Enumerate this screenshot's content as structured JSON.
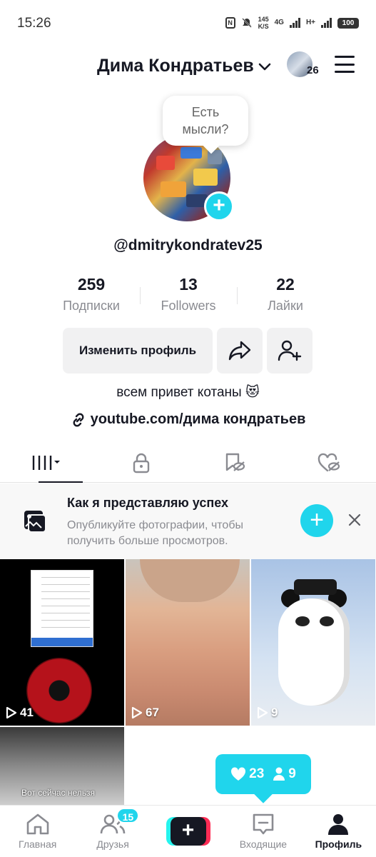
{
  "status_bar": {
    "time": "15:26",
    "speed_value": "145",
    "speed_unit": "K/S",
    "net1": "4G",
    "net2": "H+",
    "battery": "100"
  },
  "header": {
    "name": "Дима Кондратьев",
    "story_count": "26"
  },
  "avatar_bubble": {
    "line1": "Есть",
    "line2": "мысли?"
  },
  "profile": {
    "username": "@dmitrykondratev25",
    "stats": [
      {
        "value": "259",
        "label": "Подписки"
      },
      {
        "value": "13",
        "label": "Followers"
      },
      {
        "value": "22",
        "label": "Лайки"
      }
    ],
    "edit_button": "Изменить профиль",
    "bio": "всем привет котаны 😻",
    "link": "youtube.com/дима кондратьев"
  },
  "promo": {
    "title": "Как я представляю успех",
    "text": "Опубликуйте фотографии, чтобы получить больше просмотров."
  },
  "videos": [
    {
      "views": "41"
    },
    {
      "views": "67"
    },
    {
      "views": "9"
    },
    {
      "caption": "Вот сейчас нельзя"
    }
  ],
  "notification": {
    "likes": "23",
    "followers": "9"
  },
  "nav": {
    "home": "Главная",
    "friends": "Друзья",
    "friends_badge": "15",
    "inbox": "Входящие",
    "profile": "Профиль"
  },
  "colors": {
    "accent": "#20d5ec",
    "text": "#161823",
    "muted": "#8a8b91",
    "button_bg": "#f1f1f2",
    "tiktok_red": "#fe2c55",
    "tiktok_cyan": "#25f4ee"
  }
}
